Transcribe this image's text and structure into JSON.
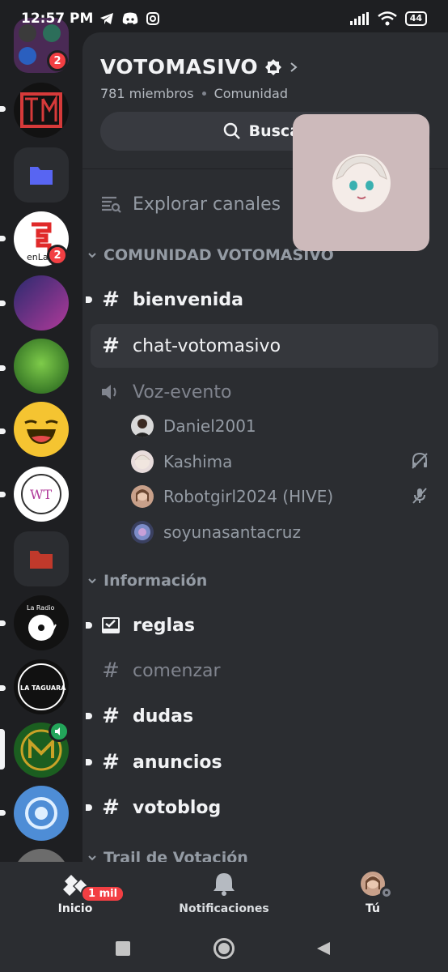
{
  "status_bar": {
    "time": "12:57 PM",
    "battery": "44"
  },
  "server": {
    "name": "VOTOMASIVO",
    "members": "781 miembros",
    "type": "Comunidad",
    "search_label": "Buscar"
  },
  "browse": {
    "label": "Explorar canales"
  },
  "categories": {
    "comunidad": "COMUNIDAD VOTOMASIVO",
    "informacion": "Información",
    "trail": "Trail de Votación"
  },
  "channels": {
    "bienvenida": "bienvenida",
    "chat": "chat-votomasivo",
    "voice": "Voz-evento",
    "reglas": "reglas",
    "comenzar": "comenzar",
    "dudas": "dudas",
    "anuncios": "anuncios",
    "votoblog": "votoblog"
  },
  "voice_users": [
    {
      "name": "Daniel2001"
    },
    {
      "name": "Kashima"
    },
    {
      "name": "Robotgirl2024 (HIVE)"
    },
    {
      "name": "soyunasantacruz"
    }
  ],
  "server_rail": {
    "badges": [
      "2",
      "2"
    ],
    "icon_texts": {
      "enlace": "enLa",
      "radio": "La Radio",
      "taguara": "LA TAGUARA BAR"
    }
  },
  "bottom_nav": {
    "home": "Inicio",
    "home_badge": "1 mil",
    "notifications": "Notificaciones",
    "you": "Tú"
  },
  "colors": {
    "background": "#1e1f22",
    "panel": "#2b2d31",
    "selected": "#35373c",
    "badge": "#f23f43",
    "text_muted": "#949ba4"
  }
}
